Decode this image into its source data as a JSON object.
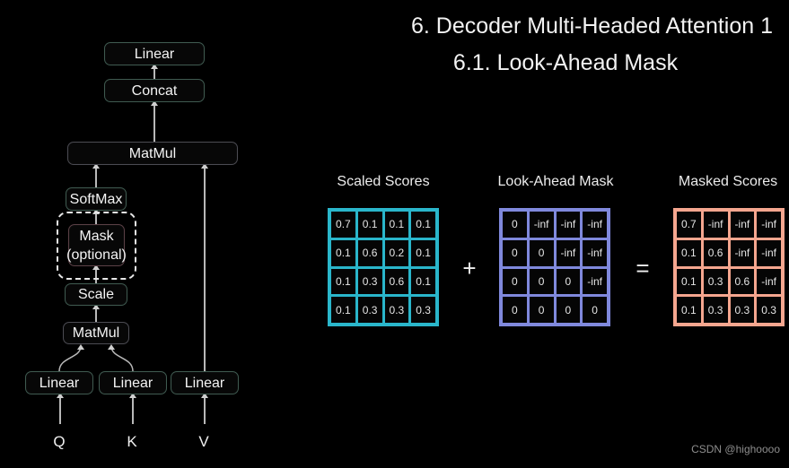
{
  "slide": {
    "title_line1": "6. Decoder Multi-Headed Attention 1",
    "title_line2": "6.1. Look-Ahead Mask",
    "watermark": "CSDN @highoooo",
    "background": "#000000"
  },
  "diagram": {
    "nodes": {
      "linear_top": "Linear",
      "concat": "Concat",
      "matmul_top": "MatMul",
      "softmax": "SoftMax",
      "mask_line1": "Mask",
      "mask_line2": "(optional)",
      "scale": "Scale",
      "matmul_bottom": "MatMul",
      "linear_q": "Linear",
      "linear_k": "Linear",
      "linear_v": "Linear"
    },
    "inputs": {
      "q": "Q",
      "k": "K",
      "v": "V"
    }
  },
  "equation": {
    "plus": "+",
    "equals": "="
  },
  "matrices": [
    {
      "title": "Scaled Scores",
      "accent": "#2ab6cb",
      "rows": [
        [
          "0.7",
          "0.1",
          "0.1",
          "0.1"
        ],
        [
          "0.1",
          "0.6",
          "0.2",
          "0.1"
        ],
        [
          "0.1",
          "0.3",
          "0.6",
          "0.1"
        ],
        [
          "0.1",
          "0.3",
          "0.3",
          "0.3"
        ]
      ]
    },
    {
      "title": "Look-Ahead Mask",
      "accent": "#8089dd",
      "rows": [
        [
          "0",
          "-inf",
          "-inf",
          "-inf"
        ],
        [
          "0",
          "0",
          "-inf",
          "-inf"
        ],
        [
          "0",
          "0",
          "0",
          "-inf"
        ],
        [
          "0",
          "0",
          "0",
          "0"
        ]
      ]
    },
    {
      "title": "Masked Scores",
      "accent": "#f5a68f",
      "rows": [
        [
          "0.7",
          "-inf",
          "-inf",
          "-inf"
        ],
        [
          "0.1",
          "0.6",
          "-inf",
          "-inf"
        ],
        [
          "0.1",
          "0.3",
          "0.6",
          "-inf"
        ],
        [
          "0.1",
          "0.3",
          "0.3",
          "0.3"
        ]
      ]
    }
  ]
}
